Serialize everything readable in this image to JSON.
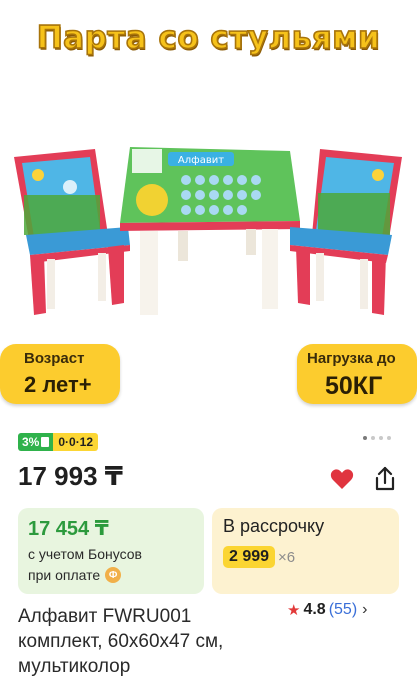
{
  "hero": {
    "title": "Парта со стульями",
    "age_label": "Возраст",
    "age_value": "2 лет+",
    "load_label": "Нагрузка до",
    "load_value": "50КГ",
    "table_sign": "Алфавит"
  },
  "gallery": {
    "dots": 4,
    "active_index": 0
  },
  "promo": {
    "percent": "3%",
    "installment": "0·0·12"
  },
  "price": {
    "value": "17 993 ₸"
  },
  "bonus": {
    "price": "17 454 ₸",
    "line1": "с учетом Бонусов",
    "line2": "при оплате",
    "badge": "Ф"
  },
  "installment": {
    "title": "В рассрочку",
    "amount": "2 999",
    "multiplier": "×6"
  },
  "product": {
    "title": "Алфавит FWRU001 комплект, 60x60x47 см, мультиколор",
    "rating": "4.8",
    "reviews": "(55)"
  },
  "icons": {
    "heart": "heart-icon",
    "share": "share-icon",
    "star": "star-icon",
    "chevron": "chevron-right-icon"
  },
  "colors": {
    "accent_yellow": "#fccc2e",
    "price_green": "#2c9a3d",
    "heart_red": "#e0343f",
    "link_blue": "#3a6fd8"
  }
}
